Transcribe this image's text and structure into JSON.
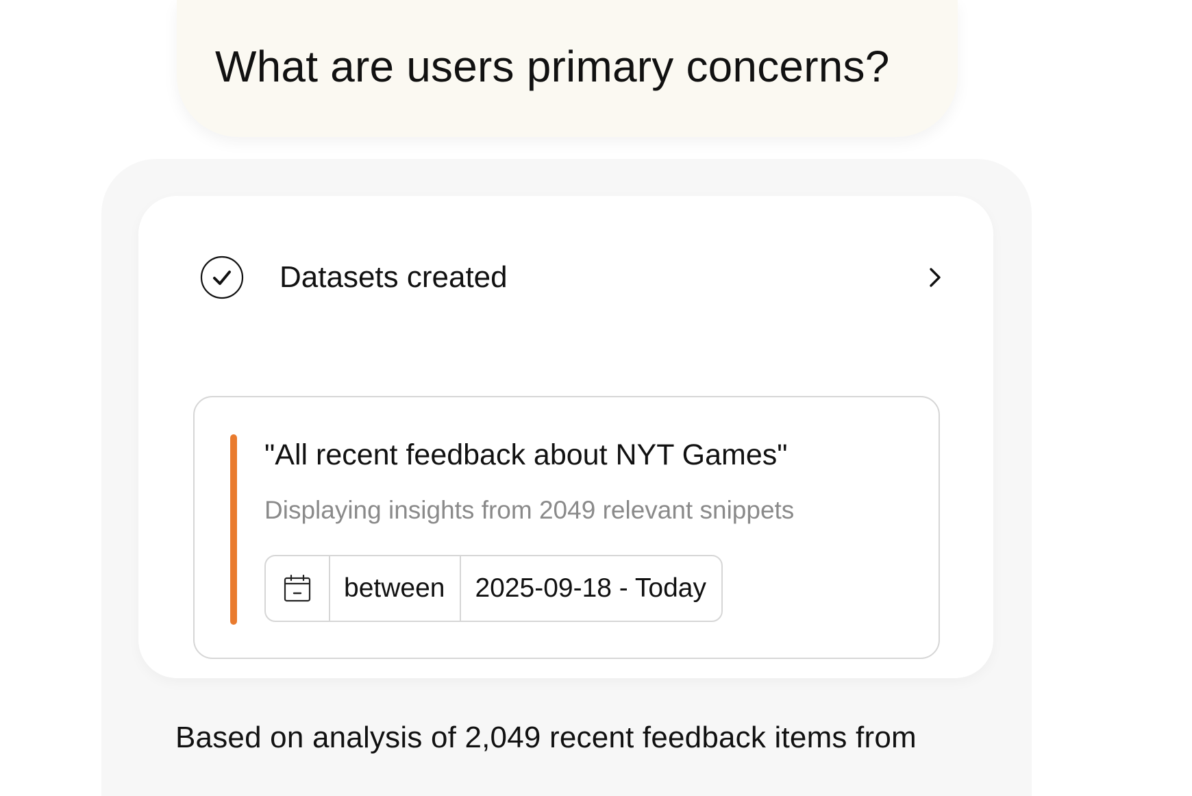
{
  "prompt": {
    "text": "What are users primary concerns?"
  },
  "status": {
    "label": "Datasets created",
    "icon": "check-circle-icon",
    "expand_icon": "chevron-right-icon"
  },
  "dataset": {
    "title": "\"All recent feedback about NYT Games\"",
    "subtitle": "Displaying insights from 2049 relevant snippets",
    "accent_color": "#e97b2e",
    "filter": {
      "icon": "calendar-icon",
      "operator": "between",
      "value": "2025-09-18 - Today"
    }
  },
  "summary": {
    "text": "Based on analysis of 2,049 recent feedback items from"
  }
}
